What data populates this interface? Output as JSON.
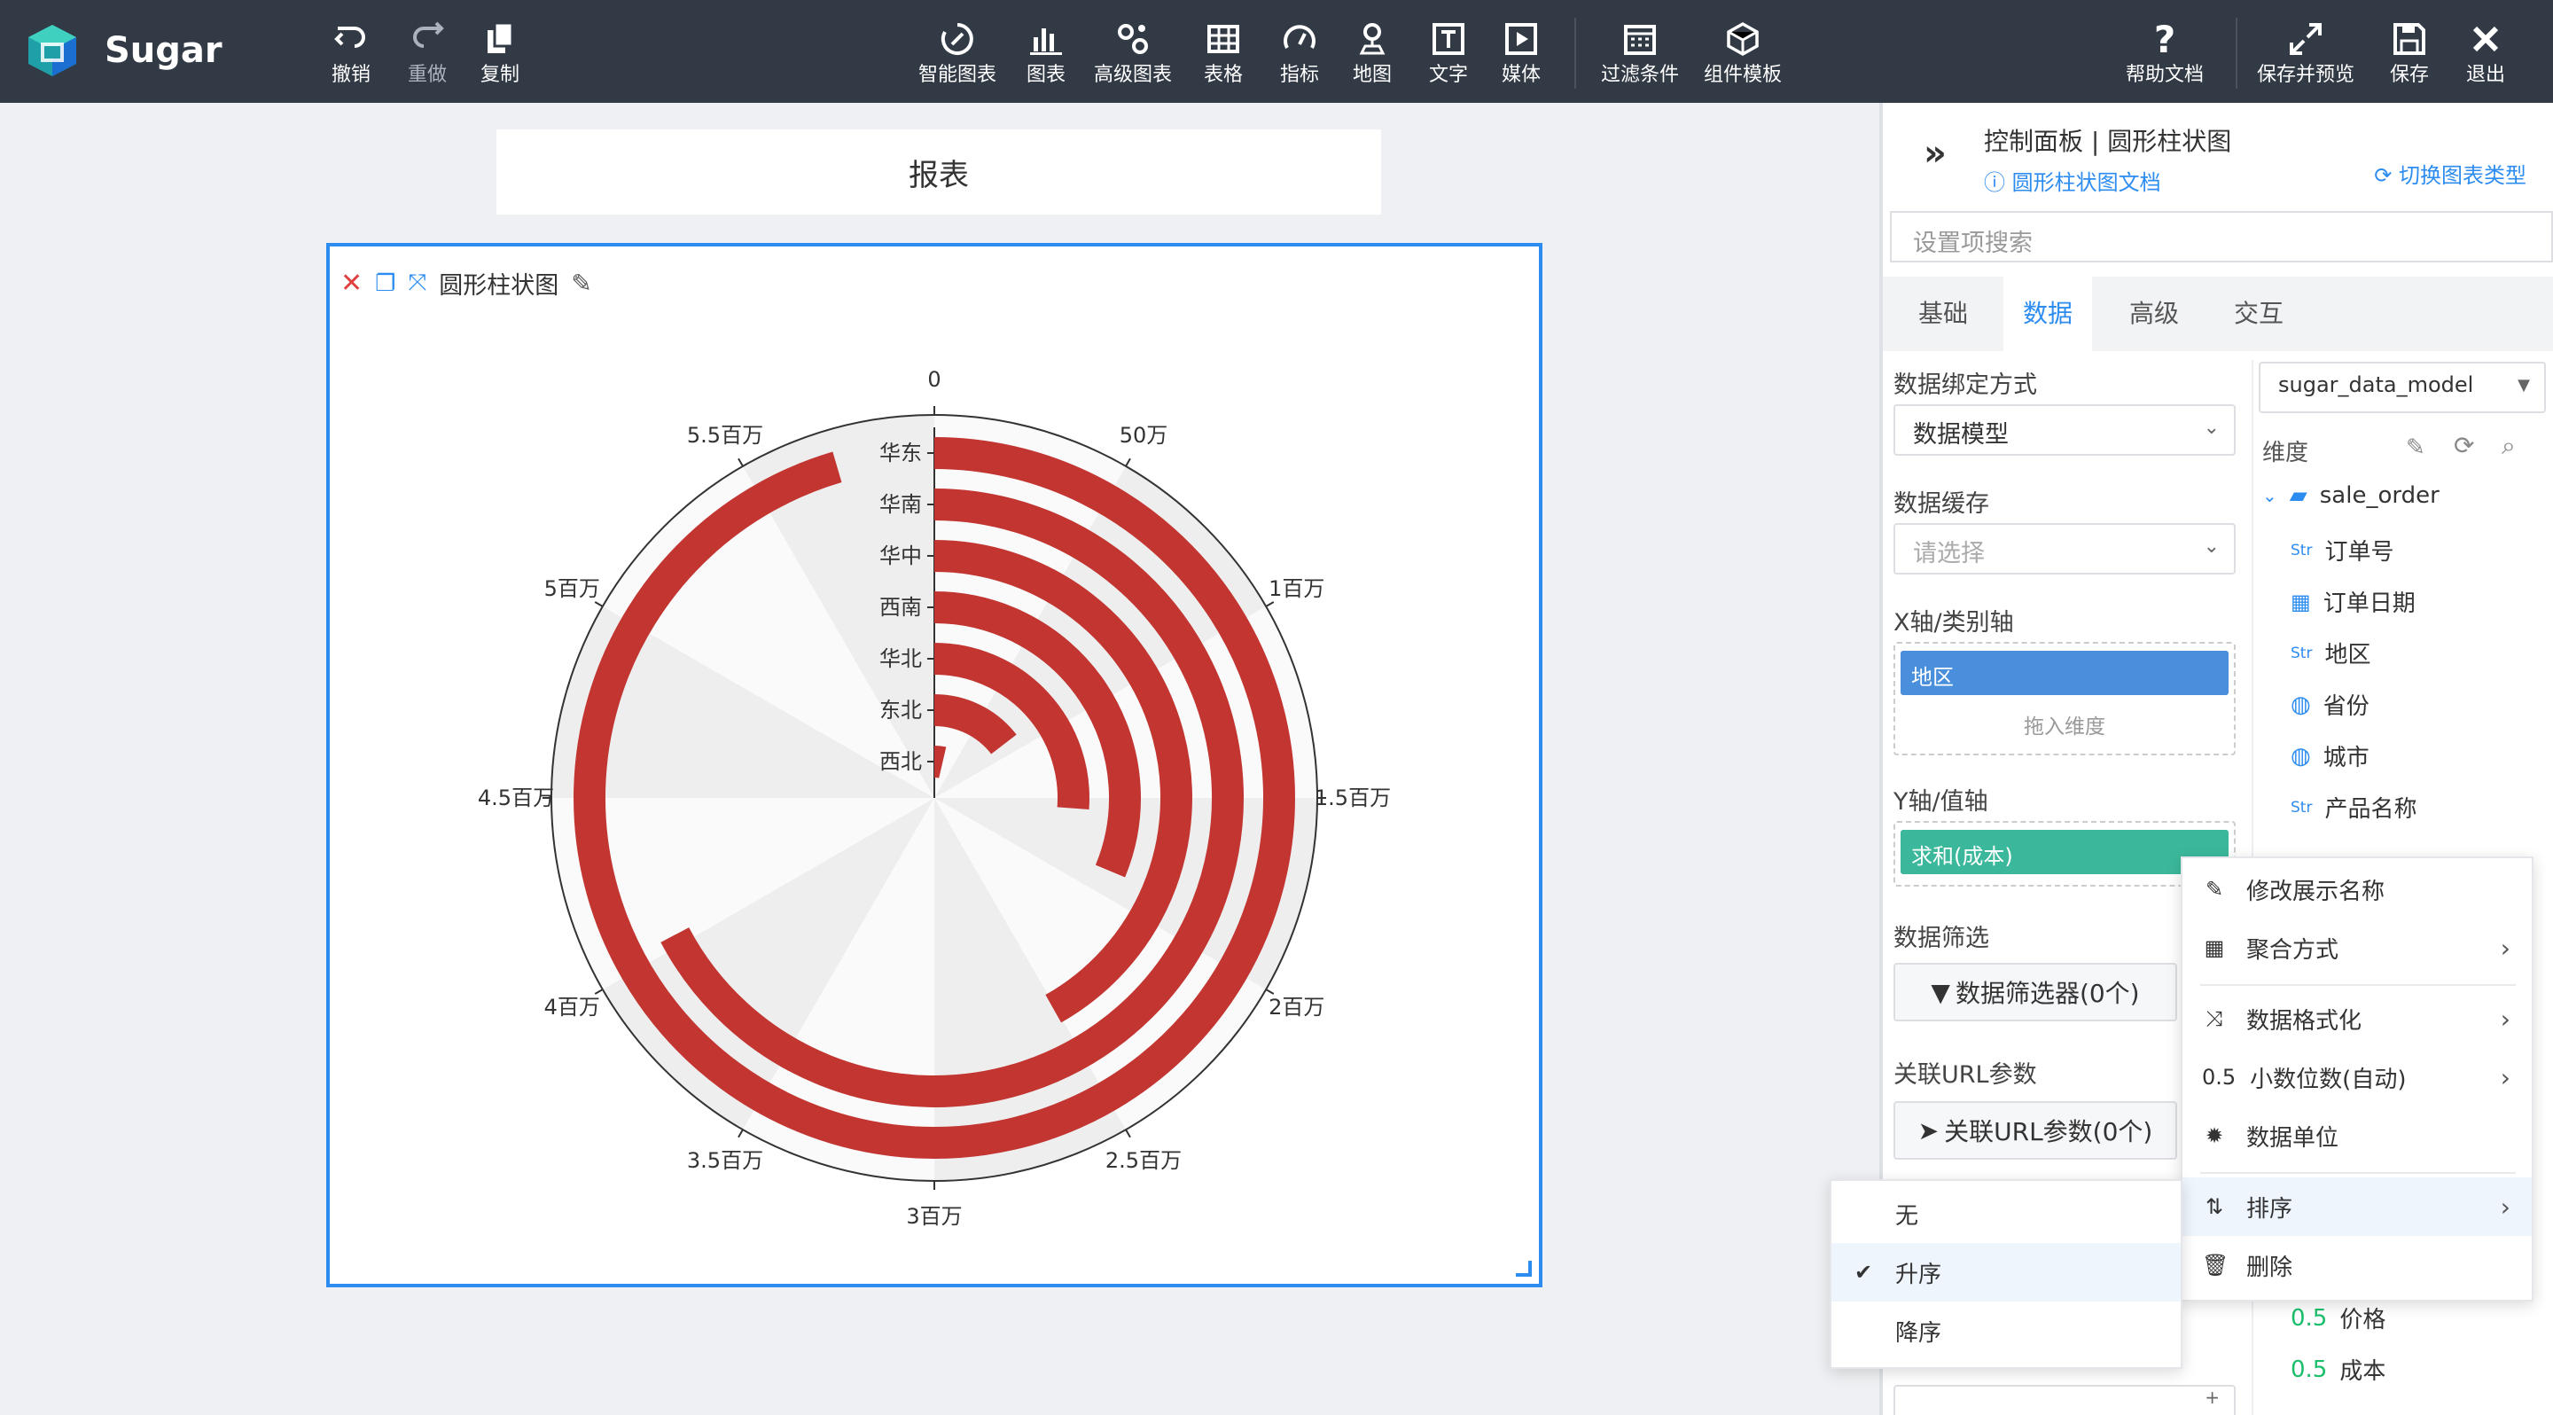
{
  "app": {
    "name": "Sugar"
  },
  "toolbar": {
    "undo": "撤销",
    "redo": "重做",
    "copy": "复制",
    "smart_chart": "智能图表",
    "chart": "图表",
    "advanced_chart": "高级图表",
    "table": "表格",
    "metric": "指标",
    "map": "地图",
    "text": "文字",
    "media": "媒体",
    "filter_condition": "过滤条件",
    "component_template": "组件模板",
    "help_doc": "帮助文档",
    "save_preview": "保存并预览",
    "save": "保存",
    "exit": "退出"
  },
  "report": {
    "title": "报表"
  },
  "chart_card": {
    "title": "圆形柱状图"
  },
  "chart_data": {
    "type": "bar",
    "polar": true,
    "categories": [
      "华东",
      "华南",
      "华中",
      "西南",
      "华北",
      "东北",
      "西北"
    ],
    "series": [
      {
        "values": [
          5250000,
          3700000,
          2300000,
          1720000,
          1440000,
          800000,
          200000
        ]
      }
    ],
    "angle_ticks": [
      "0",
      "50万",
      "1百万",
      "1.5百万",
      "2百万",
      "2.5百万",
      "3百万",
      "3.5百万",
      "4百万",
      "4.5百万",
      "5百万",
      "5.5百万"
    ],
    "angle_range": [
      0,
      5500000
    ],
    "colors": {
      "bar": "#c23531",
      "band_light": "#fafafa",
      "band_dark": "#eeeeee"
    }
  },
  "panel": {
    "title": "控制面板 | 圆形柱状图",
    "doc_link": "圆形柱状图文档",
    "switch_type": "切换图表类型",
    "search_placeholder": "设置项搜索",
    "tabs": [
      "基础",
      "数据",
      "高级",
      "交互"
    ],
    "active_tab": "数据",
    "binding_label": "数据绑定方式",
    "binding_value": "数据模型",
    "cache_label": "数据缓存",
    "cache_placeholder": "请选择",
    "x_axis_label": "X轴/类别轴",
    "x_field": "地区",
    "x_drop_hint": "拖入维度",
    "y_axis_label": "Y轴/值轴",
    "y_field": "求和(成本)",
    "filter_label": "数据筛选",
    "filter_button": "数据筛选器(0个)",
    "url_label": "关联URL参数",
    "url_button": "关联URL参数(0个)",
    "model_select": "sugar_data_model",
    "dimension_label": "维度",
    "table_name": "sale_order",
    "fields": [
      {
        "type": "Str",
        "name": "订单号"
      },
      {
        "type": "date",
        "name": "订单日期"
      },
      {
        "type": "Str",
        "name": "地区"
      },
      {
        "type": "geo",
        "name": "省份"
      },
      {
        "type": "geo",
        "name": "城市"
      },
      {
        "type": "Str",
        "name": "产品名称"
      }
    ],
    "measures": [
      {
        "type": "0.5",
        "name": "价格"
      },
      {
        "type": "0.5",
        "name": "成本"
      }
    ]
  },
  "context_menu": {
    "items": [
      "修改展示名称",
      "聚合方式",
      "数据格式化",
      "小数位数(自动)",
      "数据单位",
      "排序",
      "删除"
    ],
    "decimal_prefix": "0.5"
  },
  "sort_menu": {
    "items": [
      "无",
      "升序",
      "降序"
    ],
    "selected": "升序"
  }
}
